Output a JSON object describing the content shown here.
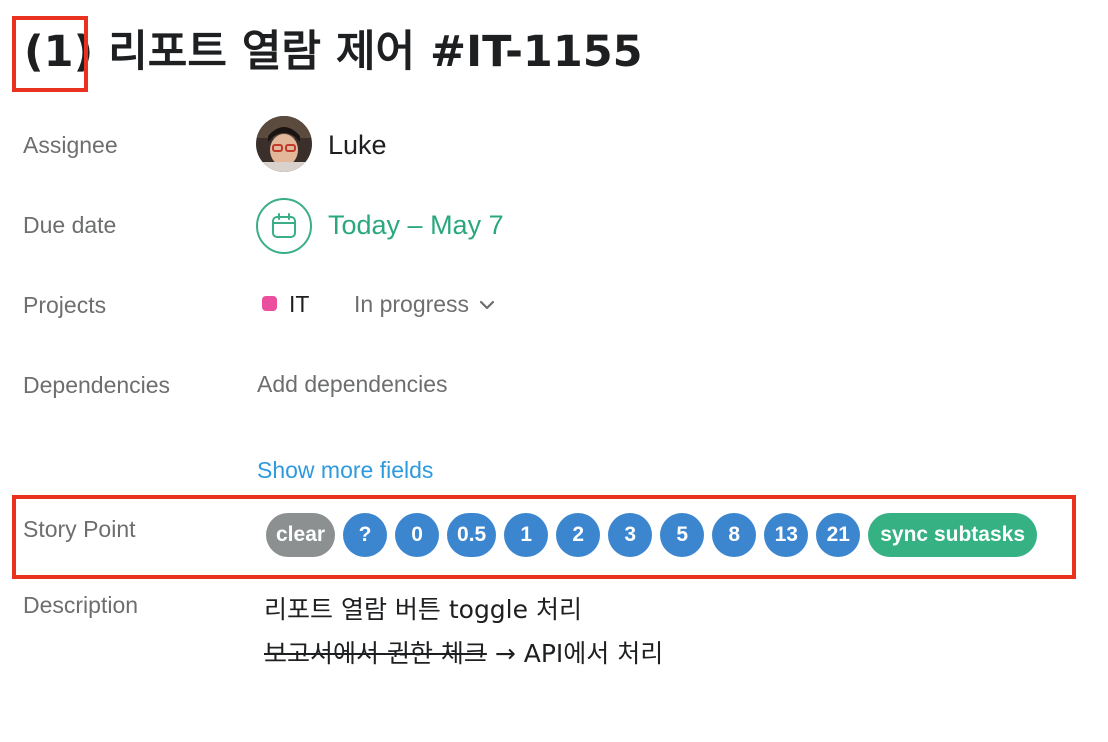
{
  "task": {
    "title_count": "(1)",
    "title_text": " 리포트 열람 제어 #IT-1155"
  },
  "fields": {
    "assignee": {
      "label": "Assignee",
      "name": "Luke"
    },
    "due_date": {
      "label": "Due date",
      "value": "Today – May 7",
      "color": "#2aa87c"
    },
    "projects": {
      "label": "Projects",
      "project_name": "IT",
      "project_color": "#ea4e9d",
      "status": "In progress"
    },
    "dependencies": {
      "label": "Dependencies",
      "action": "Add dependencies"
    },
    "show_more": "Show more fields",
    "story_point": {
      "label": "Story Point",
      "clear": "clear",
      "options": [
        "?",
        "0",
        "0.5",
        "1",
        "2",
        "3",
        "5",
        "8",
        "13",
        "21"
      ],
      "sync": "sync subtasks",
      "colors": {
        "clear": "#8c9091",
        "option": "#3b86cf",
        "sync": "#35b184"
      }
    },
    "description": {
      "label": "Description",
      "line1": "리포트 열람 버튼 toggle 처리",
      "line2_struck": "보고서에서 권한 체크",
      "line2_rest": " → API에서 처리"
    }
  },
  "annotation_color": "#e8321f"
}
